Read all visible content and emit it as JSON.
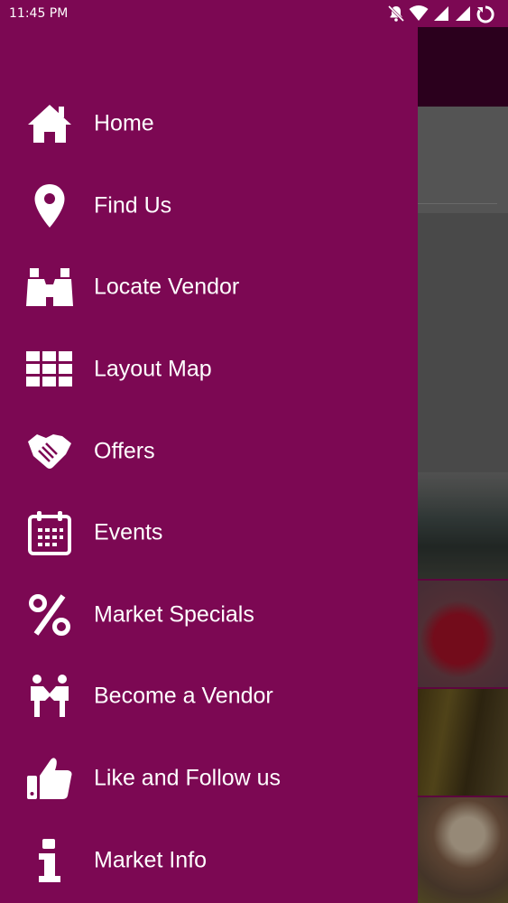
{
  "status_bar": {
    "time": "11:45 PM",
    "icons": [
      "notifications-off-icon",
      "wifi-icon",
      "signal-icon",
      "signal-icon",
      "sync-icon"
    ]
  },
  "drawer": {
    "background_color": "#7c0853",
    "text_color": "#ffffff",
    "items": [
      {
        "label": "Home",
        "icon": "home-icon"
      },
      {
        "label": "Find Us",
        "icon": "location-pin-icon"
      },
      {
        "label": "Locate Vendor",
        "icon": "binoculars-icon"
      },
      {
        "label": "Layout Map",
        "icon": "grid-icon"
      },
      {
        "label": "Offers",
        "icon": "handshake-icon"
      },
      {
        "label": "Events",
        "icon": "calendar-icon"
      },
      {
        "label": "Market Specials",
        "icon": "percent-icon"
      },
      {
        "label": "Become a Vendor",
        "icon": "people-icon"
      },
      {
        "label": "Like and Follow us",
        "icon": "thumbs-up-icon"
      },
      {
        "label": "Market Info",
        "icon": "info-icon"
      }
    ]
  }
}
